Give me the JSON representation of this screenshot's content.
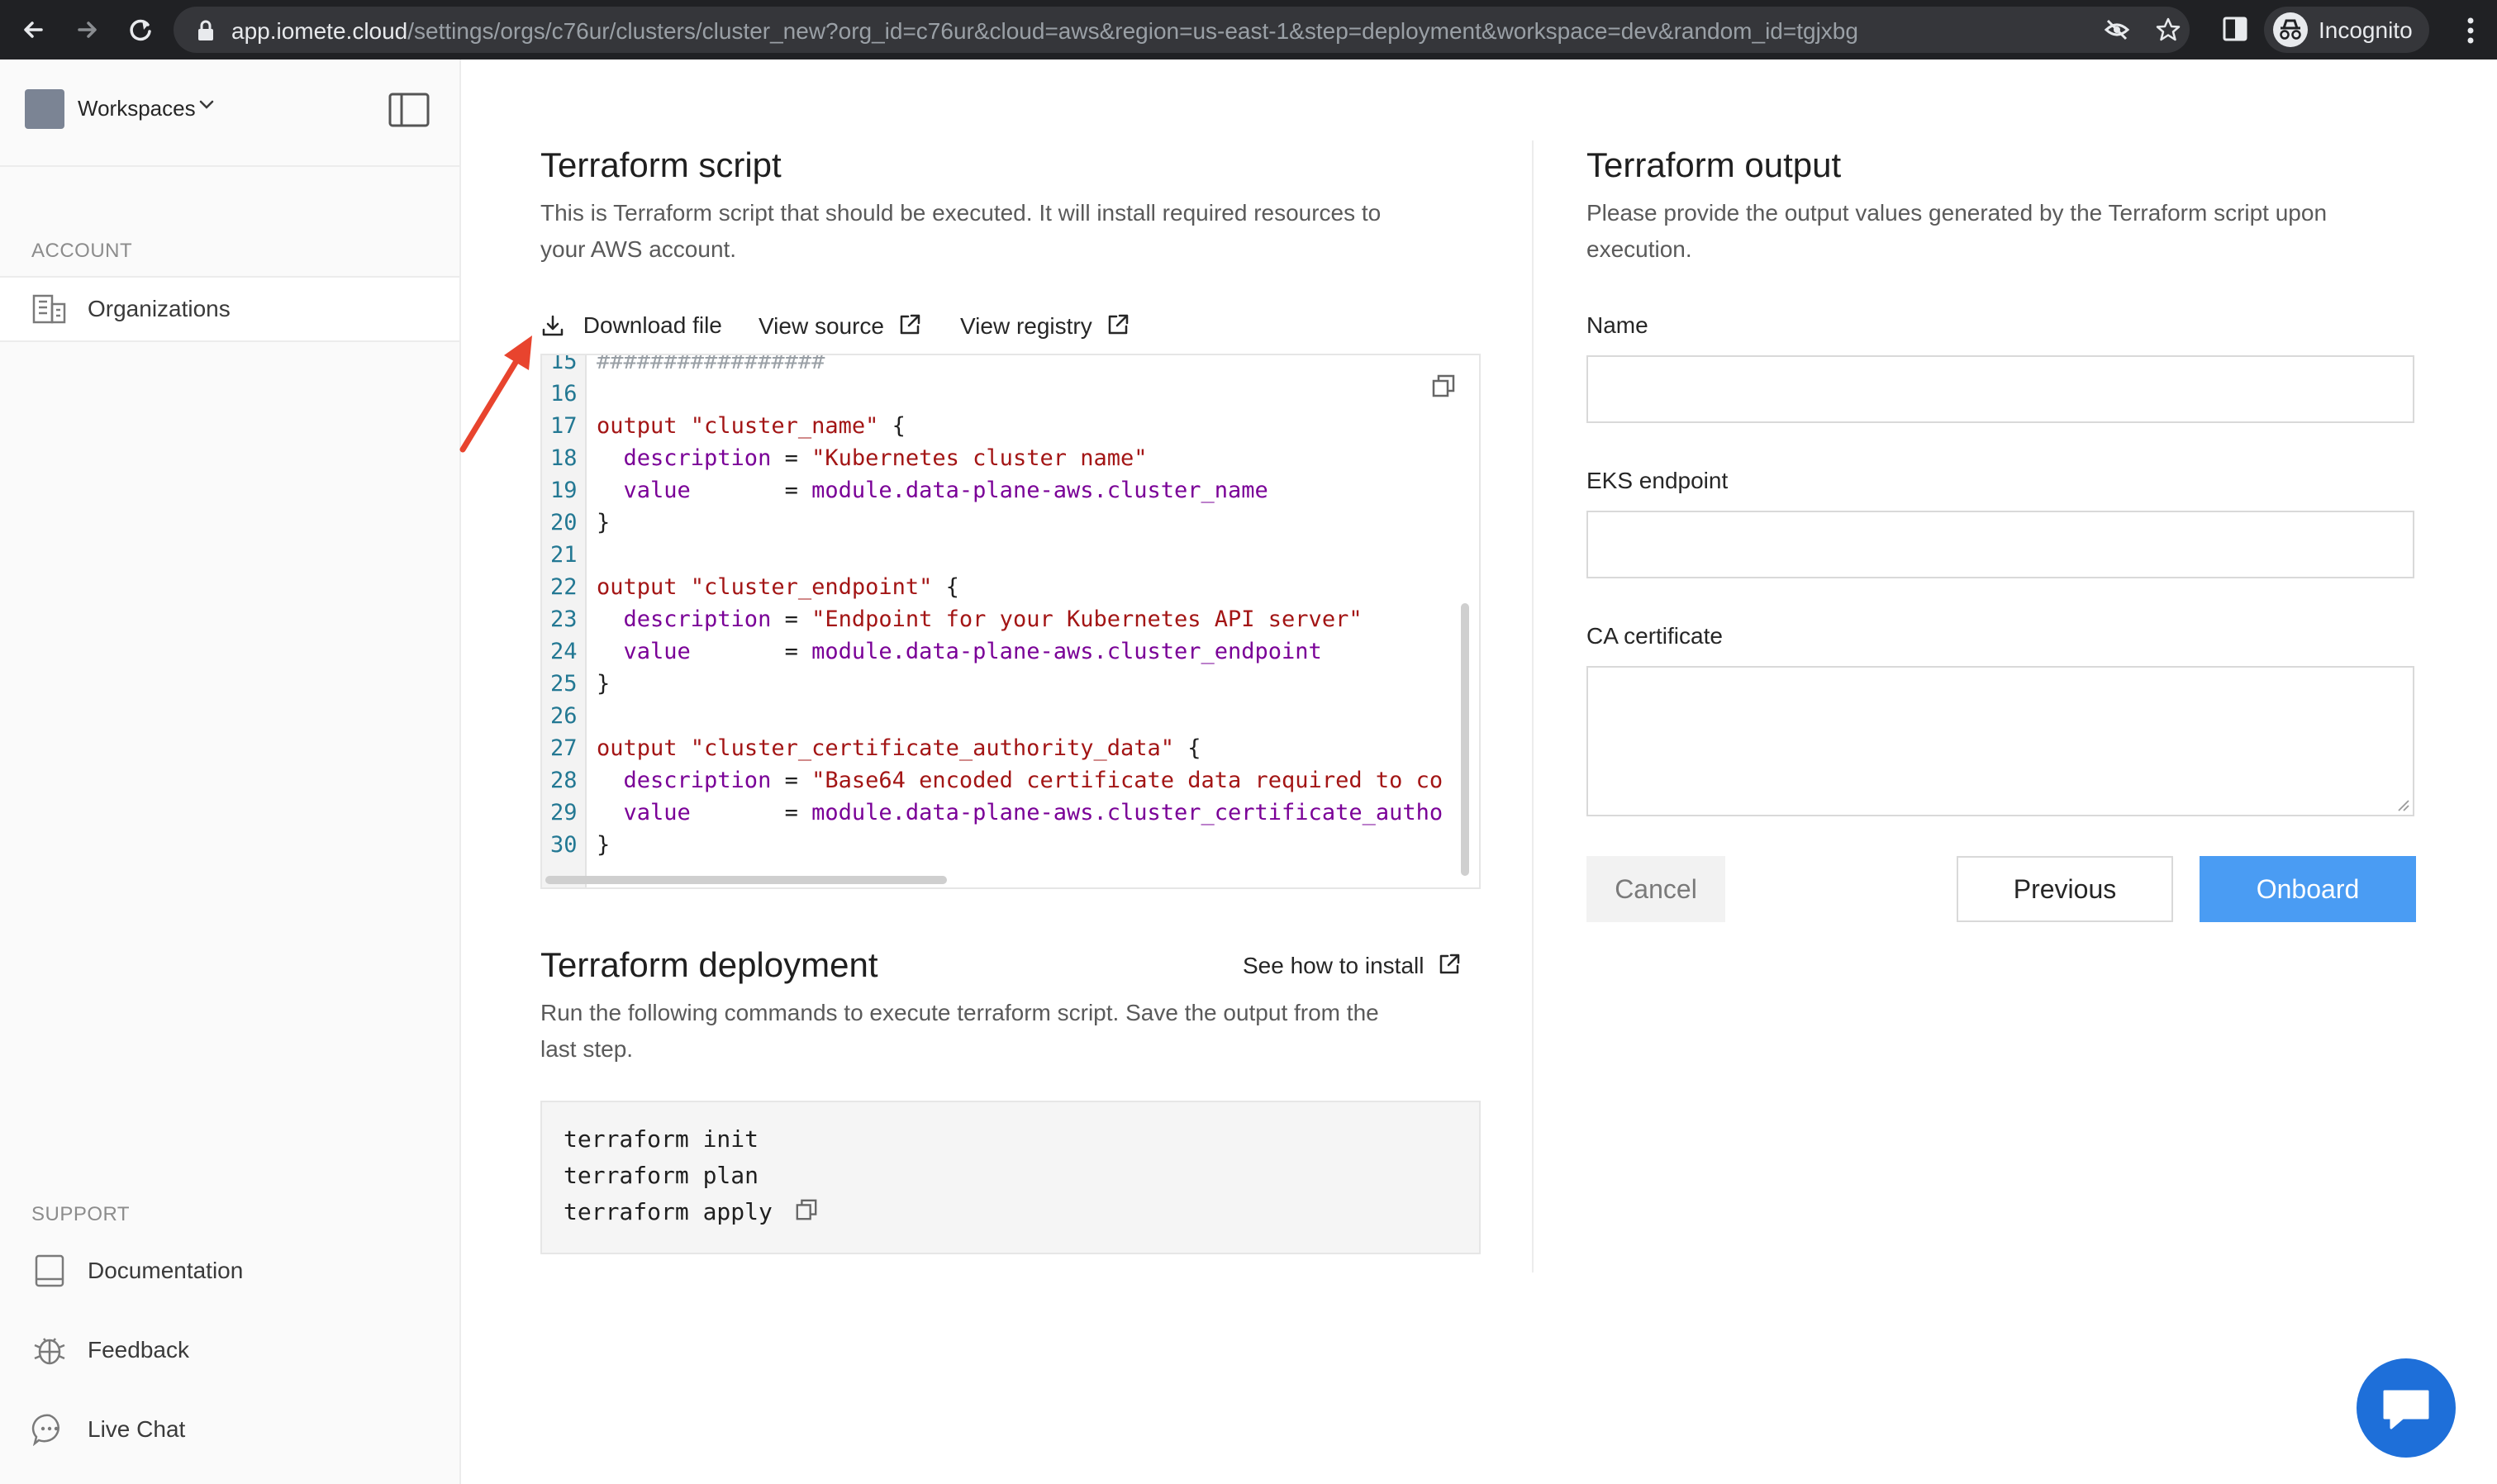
{
  "browser": {
    "url_host": "app.iomete.cloud",
    "url_path": "/settings/orgs/c76ur/clusters/cluster_new?org_id=c76ur&cloud=aws&region=us-east-1&step=deployment&workspace=dev&random_id=tgjxbg",
    "incognito_label": "Incognito"
  },
  "sidebar": {
    "workspace_label": "Workspaces",
    "account_section": "ACCOUNT",
    "account_items": [
      {
        "label": "Organizations",
        "icon": "building-icon"
      }
    ],
    "support_section": "SUPPORT",
    "support_items": [
      {
        "label": "Documentation",
        "icon": "book-icon"
      },
      {
        "label": "Feedback",
        "icon": "bug-icon"
      },
      {
        "label": "Live Chat",
        "icon": "chat-icon"
      }
    ]
  },
  "script": {
    "title": "Terraform script",
    "description_line1": "This is Terraform script that should be executed. It will install required resources to",
    "description_line2": "your AWS account.",
    "download_label": "Download file",
    "view_source_label": "View source",
    "view_registry_label": "View registry",
    "code_lines": [
      {
        "n": "15",
        "parts": [
          {
            "t": "#################",
            "c": "hash"
          }
        ]
      },
      {
        "n": "16",
        "parts": []
      },
      {
        "n": "17",
        "parts": [
          {
            "t": "output ",
            "c": "kw"
          },
          {
            "t": "\"cluster_name\"",
            "c": "str"
          },
          {
            "t": " {",
            "c": "op"
          }
        ]
      },
      {
        "n": "18",
        "parts": [
          {
            "t": "  description",
            "c": "kw2"
          },
          {
            "t": " = ",
            "c": "op"
          },
          {
            "t": "\"Kubernetes cluster name\"",
            "c": "str"
          }
        ]
      },
      {
        "n": "19",
        "parts": [
          {
            "t": "  value",
            "c": "kw2"
          },
          {
            "t": "       = ",
            "c": "op"
          },
          {
            "t": "module.data-plane-aws.cluster_name",
            "c": "ref"
          }
        ]
      },
      {
        "n": "20",
        "parts": [
          {
            "t": "}",
            "c": "op"
          }
        ]
      },
      {
        "n": "21",
        "parts": []
      },
      {
        "n": "22",
        "parts": [
          {
            "t": "output ",
            "c": "kw"
          },
          {
            "t": "\"cluster_endpoint\"",
            "c": "str"
          },
          {
            "t": " {",
            "c": "op"
          }
        ]
      },
      {
        "n": "23",
        "parts": [
          {
            "t": "  description",
            "c": "kw2"
          },
          {
            "t": " = ",
            "c": "op"
          },
          {
            "t": "\"Endpoint for your Kubernetes API server\"",
            "c": "str"
          }
        ]
      },
      {
        "n": "24",
        "parts": [
          {
            "t": "  value",
            "c": "kw2"
          },
          {
            "t": "       = ",
            "c": "op"
          },
          {
            "t": "module.data-plane-aws.cluster_endpoint",
            "c": "ref"
          }
        ]
      },
      {
        "n": "25",
        "parts": [
          {
            "t": "}",
            "c": "op"
          }
        ]
      },
      {
        "n": "26",
        "parts": []
      },
      {
        "n": "27",
        "parts": [
          {
            "t": "output ",
            "c": "kw"
          },
          {
            "t": "\"cluster_certificate_authority_data\"",
            "c": "str"
          },
          {
            "t": " {",
            "c": "op"
          }
        ]
      },
      {
        "n": "28",
        "parts": [
          {
            "t": "  description",
            "c": "kw2"
          },
          {
            "t": " = ",
            "c": "op"
          },
          {
            "t": "\"Base64 encoded certificate data required to co",
            "c": "str"
          }
        ]
      },
      {
        "n": "29",
        "parts": [
          {
            "t": "  value",
            "c": "kw2"
          },
          {
            "t": "       = ",
            "c": "op"
          },
          {
            "t": "module.data-plane-aws.cluster_certificate_autho",
            "c": "ref"
          }
        ]
      },
      {
        "n": "30",
        "parts": [
          {
            "t": "}",
            "c": "op"
          }
        ]
      }
    ]
  },
  "deployment": {
    "title": "Terraform deployment",
    "how_to_label": "See how to install",
    "description_line1": "Run the following commands to execute terraform script. Save the output from the",
    "description_line2": "last step.",
    "commands": [
      "terraform init",
      "terraform plan",
      "terraform apply"
    ]
  },
  "output": {
    "title": "Terraform output",
    "description_line1": "Please provide the output values generated by the Terraform script upon",
    "description_line2": "execution.",
    "fields": {
      "name": {
        "label": "Name",
        "value": ""
      },
      "eks": {
        "label": "EKS endpoint",
        "value": ""
      },
      "ca": {
        "label": "CA certificate",
        "value": ""
      }
    },
    "cancel_label": "Cancel",
    "previous_label": "Previous",
    "onboard_label": "Onboard"
  },
  "colors": {
    "primary": "#4a9cf3",
    "chat": "#1e6fd9",
    "annotation_arrow": "#e8442e"
  }
}
